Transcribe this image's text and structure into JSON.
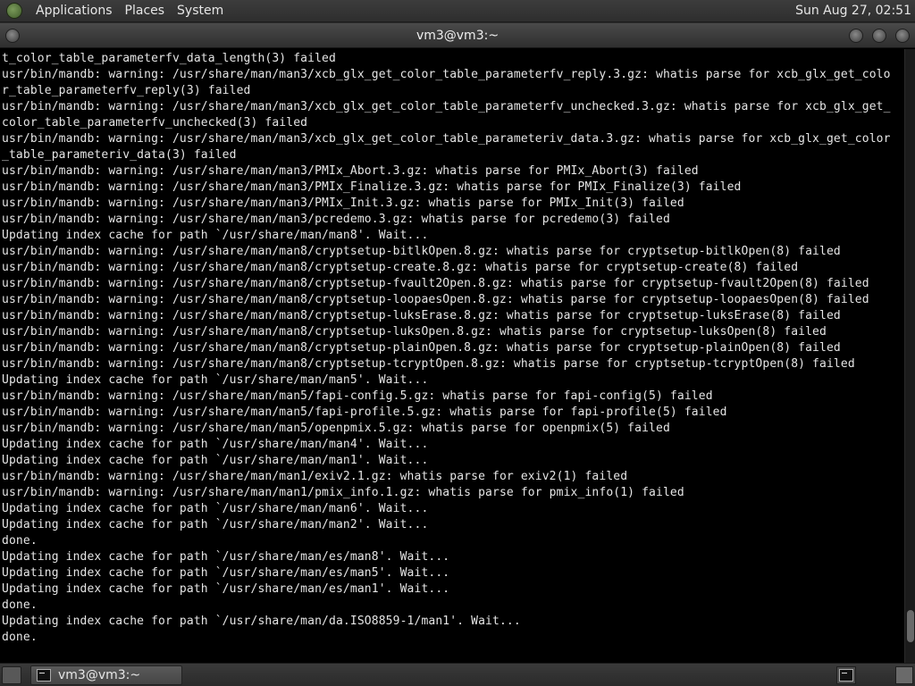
{
  "top_panel": {
    "menus": [
      "Applications",
      "Places",
      "System"
    ],
    "clock": "Sun Aug 27, 02:51"
  },
  "window": {
    "title": "vm3@vm3:~"
  },
  "terminal": {
    "lines": [
      "t_color_table_parameterfv_data_length(3) failed",
      "usr/bin/mandb: warning: /usr/share/man/man3/xcb_glx_get_color_table_parameterfv_reply.3.gz: whatis parse for xcb_glx_get_colo",
      "r_table_parameterfv_reply(3) failed",
      "usr/bin/mandb: warning: /usr/share/man/man3/xcb_glx_get_color_table_parameterfv_unchecked.3.gz: whatis parse for xcb_glx_get_",
      "color_table_parameterfv_unchecked(3) failed",
      "usr/bin/mandb: warning: /usr/share/man/man3/xcb_glx_get_color_table_parameteriv_data.3.gz: whatis parse for xcb_glx_get_color",
      "_table_parameteriv_data(3) failed",
      "usr/bin/mandb: warning: /usr/share/man/man3/PMIx_Abort.3.gz: whatis parse for PMIx_Abort(3) failed",
      "usr/bin/mandb: warning: /usr/share/man/man3/PMIx_Finalize.3.gz: whatis parse for PMIx_Finalize(3) failed",
      "usr/bin/mandb: warning: /usr/share/man/man3/PMIx_Init.3.gz: whatis parse for PMIx_Init(3) failed",
      "usr/bin/mandb: warning: /usr/share/man/man3/pcredemo.3.gz: whatis parse for pcredemo(3) failed",
      "Updating index cache for path `/usr/share/man/man8'. Wait...",
      "usr/bin/mandb: warning: /usr/share/man/man8/cryptsetup-bitlkOpen.8.gz: whatis parse for cryptsetup-bitlkOpen(8) failed",
      "usr/bin/mandb: warning: /usr/share/man/man8/cryptsetup-create.8.gz: whatis parse for cryptsetup-create(8) failed",
      "usr/bin/mandb: warning: /usr/share/man/man8/cryptsetup-fvault2Open.8.gz: whatis parse for cryptsetup-fvault2Open(8) failed",
      "usr/bin/mandb: warning: /usr/share/man/man8/cryptsetup-loopaesOpen.8.gz: whatis parse for cryptsetup-loopaesOpen(8) failed",
      "usr/bin/mandb: warning: /usr/share/man/man8/cryptsetup-luksErase.8.gz: whatis parse for cryptsetup-luksErase(8) failed",
      "usr/bin/mandb: warning: /usr/share/man/man8/cryptsetup-luksOpen.8.gz: whatis parse for cryptsetup-luksOpen(8) failed",
      "usr/bin/mandb: warning: /usr/share/man/man8/cryptsetup-plainOpen.8.gz: whatis parse for cryptsetup-plainOpen(8) failed",
      "usr/bin/mandb: warning: /usr/share/man/man8/cryptsetup-tcryptOpen.8.gz: whatis parse for cryptsetup-tcryptOpen(8) failed",
      "Updating index cache for path `/usr/share/man/man5'. Wait...",
      "usr/bin/mandb: warning: /usr/share/man/man5/fapi-config.5.gz: whatis parse for fapi-config(5) failed",
      "usr/bin/mandb: warning: /usr/share/man/man5/fapi-profile.5.gz: whatis parse for fapi-profile(5) failed",
      "usr/bin/mandb: warning: /usr/share/man/man5/openpmix.5.gz: whatis parse for openpmix(5) failed",
      "Updating index cache for path `/usr/share/man/man4'. Wait...",
      "Updating index cache for path `/usr/share/man/man1'. Wait...",
      "usr/bin/mandb: warning: /usr/share/man/man1/exiv2.1.gz: whatis parse for exiv2(1) failed",
      "usr/bin/mandb: warning: /usr/share/man/man1/pmix_info.1.gz: whatis parse for pmix_info(1) failed",
      "Updating index cache for path `/usr/share/man/man6'. Wait...",
      "Updating index cache for path `/usr/share/man/man2'. Wait...",
      "done.",
      "Updating index cache for path `/usr/share/man/es/man8'. Wait...",
      "Updating index cache for path `/usr/share/man/es/man5'. Wait...",
      "Updating index cache for path `/usr/share/man/es/man1'. Wait...",
      "done.",
      "Updating index cache for path `/usr/share/man/da.ISO8859-1/man1'. Wait...",
      "done."
    ],
    "scroll_position": 0.97
  },
  "taskbar": {
    "task_label": "vm3@vm3:~"
  },
  "colors": {
    "terminal_bg": "#000000",
    "terminal_fg": "#e5e5e5",
    "panel_bg": "#333333"
  }
}
